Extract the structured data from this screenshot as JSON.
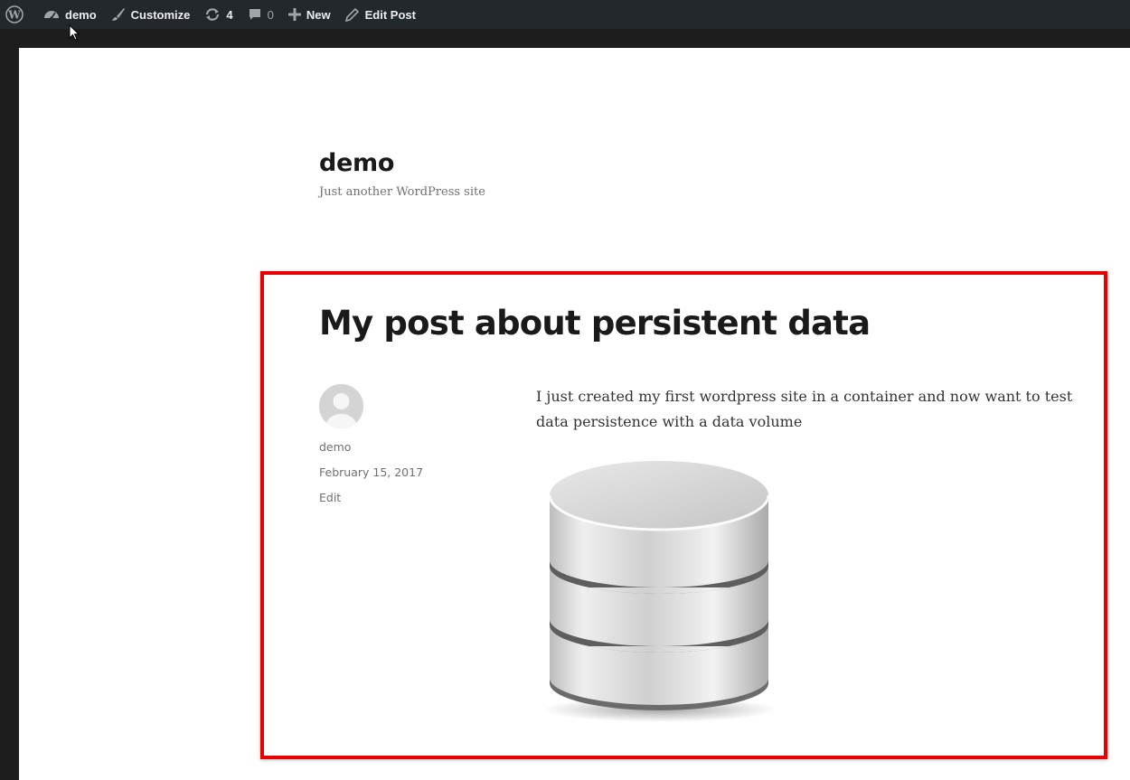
{
  "admin_bar": {
    "site_name": "demo",
    "customize_label": "Customize",
    "updates_count": "4",
    "comments_count": "0",
    "new_label": "New",
    "edit_post_label": "Edit Post"
  },
  "site": {
    "title": "demo",
    "description": "Just another WordPress site"
  },
  "post": {
    "title": "My post about persistent data",
    "author": "demo",
    "date": "February 15, 2017",
    "edit_label": "Edit",
    "content": "I just created my first wordpress site in a container and now want to test data persistence with a data volume",
    "image_icon": "database-icon"
  },
  "colors": {
    "admin_bar_bg": "#23282d",
    "highlight_border": "#e60000"
  }
}
